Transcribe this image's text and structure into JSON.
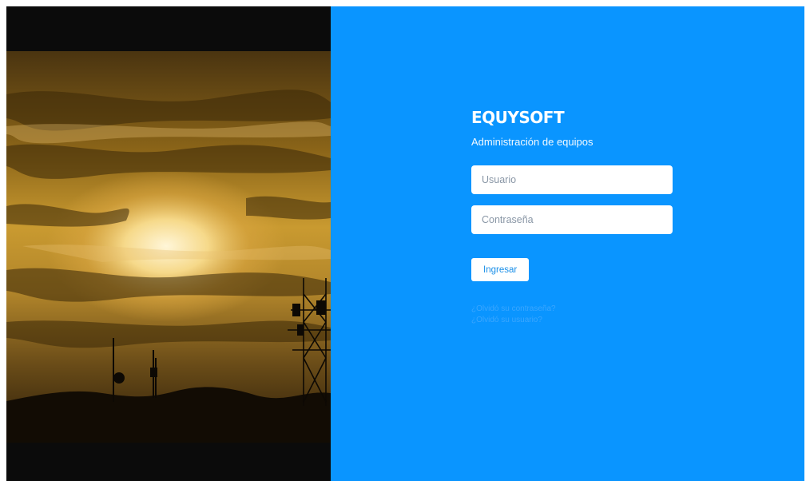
{
  "brand": {
    "name": "EQUYSOFT",
    "subtitle": "Administración de equipos"
  },
  "form": {
    "username_placeholder": "Usuario",
    "username_value": "",
    "password_placeholder": "Contraseña",
    "password_value": "",
    "submit_label": "Ingresar"
  },
  "links": {
    "forgot_password": "¿Olvidó su contraseña?",
    "forgot_username": "¿Olvidó su usuario?"
  },
  "colors": {
    "panel_background": "#0a95ff",
    "button_text": "#1a8fe8",
    "link_text": "#3aa6ff"
  },
  "images": {
    "hero": "sunset-with-telecom-towers"
  }
}
